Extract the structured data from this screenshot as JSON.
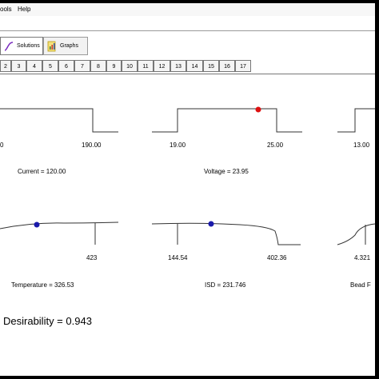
{
  "menu": {
    "items": [
      "ools",
      "Help"
    ]
  },
  "toolbar": {
    "solutions_label": "Solutions",
    "graphs_label": "Graphs"
  },
  "tabs": [
    "2",
    "3",
    "4",
    "5",
    "6",
    "7",
    "8",
    "9",
    "10",
    "11",
    "12",
    "13",
    "14",
    "15",
    "16",
    "17"
  ],
  "plots": {
    "current": {
      "right_tick": "190.00",
      "left_tick": "0",
      "label": "Current = 120.00"
    },
    "voltage": {
      "left_tick": "19.00",
      "right_tick": "25.00",
      "label": "Voltage = 23.95"
    },
    "third_top": {
      "left_tick": "13.00"
    },
    "temperature": {
      "right_tick": "423",
      "label": "Temperature = 326.53"
    },
    "isd": {
      "left_tick": "144.54",
      "right_tick": "402.36",
      "label": "ISD = 231.746"
    },
    "bead": {
      "left_tick": "4.321",
      "label": "Bead F"
    }
  },
  "desirability": "Desirability = 0.943",
  "colors": {
    "marker_red": "#dd1111",
    "marker_blue": "#1a1aaa",
    "solutions_icon": "#7a2bbf",
    "graphs_icon": "#e0c020"
  },
  "icons": {
    "solutions": "solutions-curve-icon",
    "graphs": "graphs-chart-icon"
  }
}
